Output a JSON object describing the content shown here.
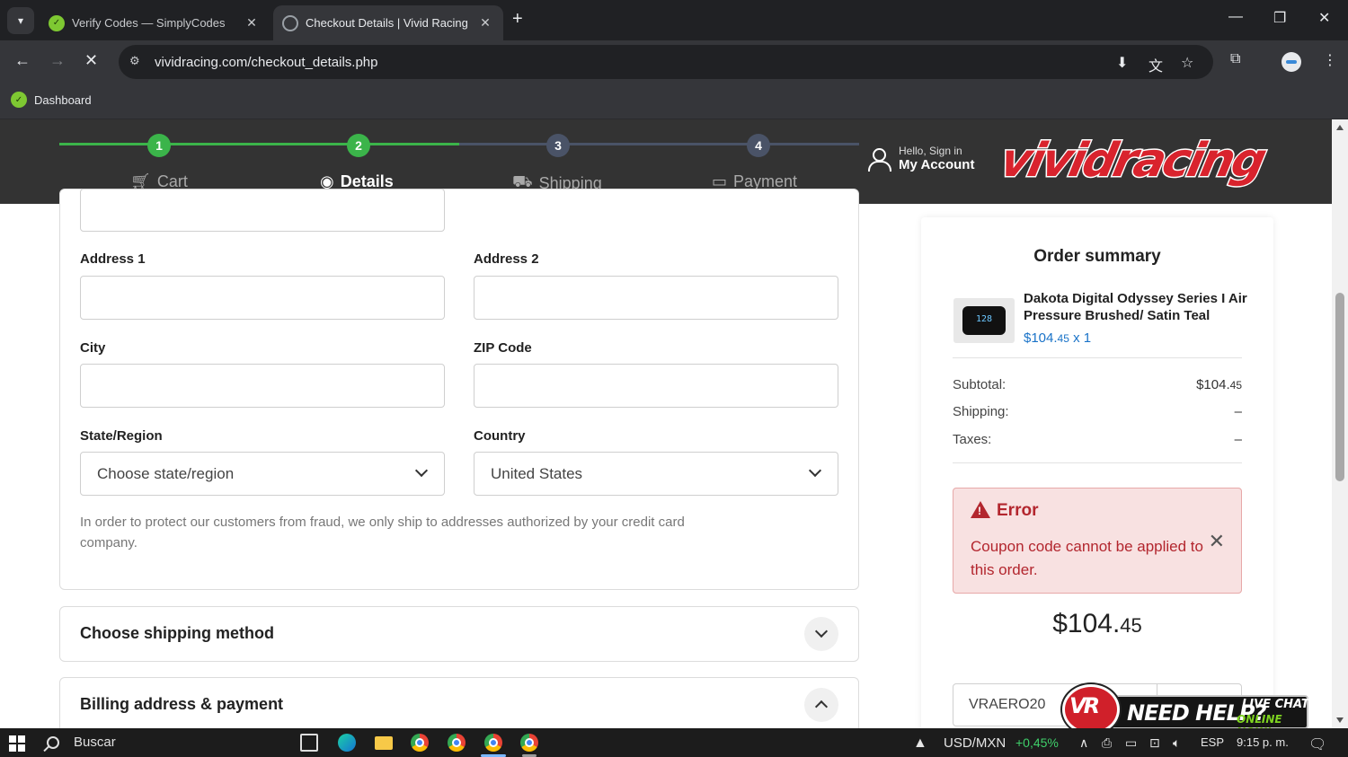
{
  "browser": {
    "tabs": [
      {
        "title": "Verify Codes — SimplyCodes",
        "active": false
      },
      {
        "title": "Checkout Details | Vivid Racing",
        "active": true
      }
    ],
    "url": "vividracing.com/checkout_details.php",
    "bookmarks": [
      {
        "label": "Dashboard"
      }
    ]
  },
  "header": {
    "steps": [
      {
        "number": "1",
        "label": "Cart",
        "icon": "cart-icon",
        "state": "done"
      },
      {
        "number": "2",
        "label": "Details",
        "icon": "user-circle-icon",
        "state": "current"
      },
      {
        "number": "3",
        "label": "Shipping",
        "icon": "truck-icon",
        "state": "pending"
      },
      {
        "number": "4",
        "label": "Payment",
        "icon": "card-icon",
        "state": "pending"
      }
    ],
    "account": {
      "greeting": "Hello, Sign in",
      "label": "My Account"
    },
    "logo_text": "vividracing",
    "colors": {
      "done": "#3bb44a",
      "pending": "#4a5367",
      "brand": "#d9232d"
    }
  },
  "form": {
    "address1": {
      "label": "Address 1",
      "value": ""
    },
    "address2": {
      "label": "Address 2",
      "value": ""
    },
    "city": {
      "label": "City",
      "value": ""
    },
    "zip": {
      "label": "ZIP Code",
      "value": ""
    },
    "state": {
      "label": "State/Region",
      "value": "Choose state/region"
    },
    "country": {
      "label": "Country",
      "value": "United States"
    },
    "fraud_note": "In order to protect our customers from fraud, we only ship to addresses authorized by your credit card company."
  },
  "sections": {
    "shipping": {
      "title": "Choose shipping method",
      "expanded": false
    },
    "billing": {
      "title": "Billing address & payment",
      "expanded": true
    }
  },
  "summary": {
    "title": "Order summary",
    "product": {
      "name": "Dakota Digital Odyssey Series I Air Pressure Brushed/ Satin Teal",
      "price_main": "$104.",
      "price_cents": "45",
      "qty": "x 1"
    },
    "subtotal": {
      "label": "Subtotal:",
      "main": "$104.",
      "cents": "45"
    },
    "shipping": {
      "label": "Shipping:",
      "value": "–"
    },
    "taxes": {
      "label": "Taxes:",
      "value": "–"
    },
    "error": {
      "title": "Error",
      "message": "Coupon code cannot be applied to this order."
    },
    "total": {
      "main": "$104.",
      "cents": "45"
    },
    "coupon_value": "VRAERO20"
  },
  "livechat": {
    "help": "NEED HELP?",
    "live": "LIVE CHAT",
    "online": "ONLINE NOW!",
    "logo": "VR"
  },
  "taskbar": {
    "search_label": "Buscar",
    "ticker": "USD/MXN",
    "ticker_change": "+0,45%",
    "language": "ESP",
    "time": "9:15 p. m."
  }
}
